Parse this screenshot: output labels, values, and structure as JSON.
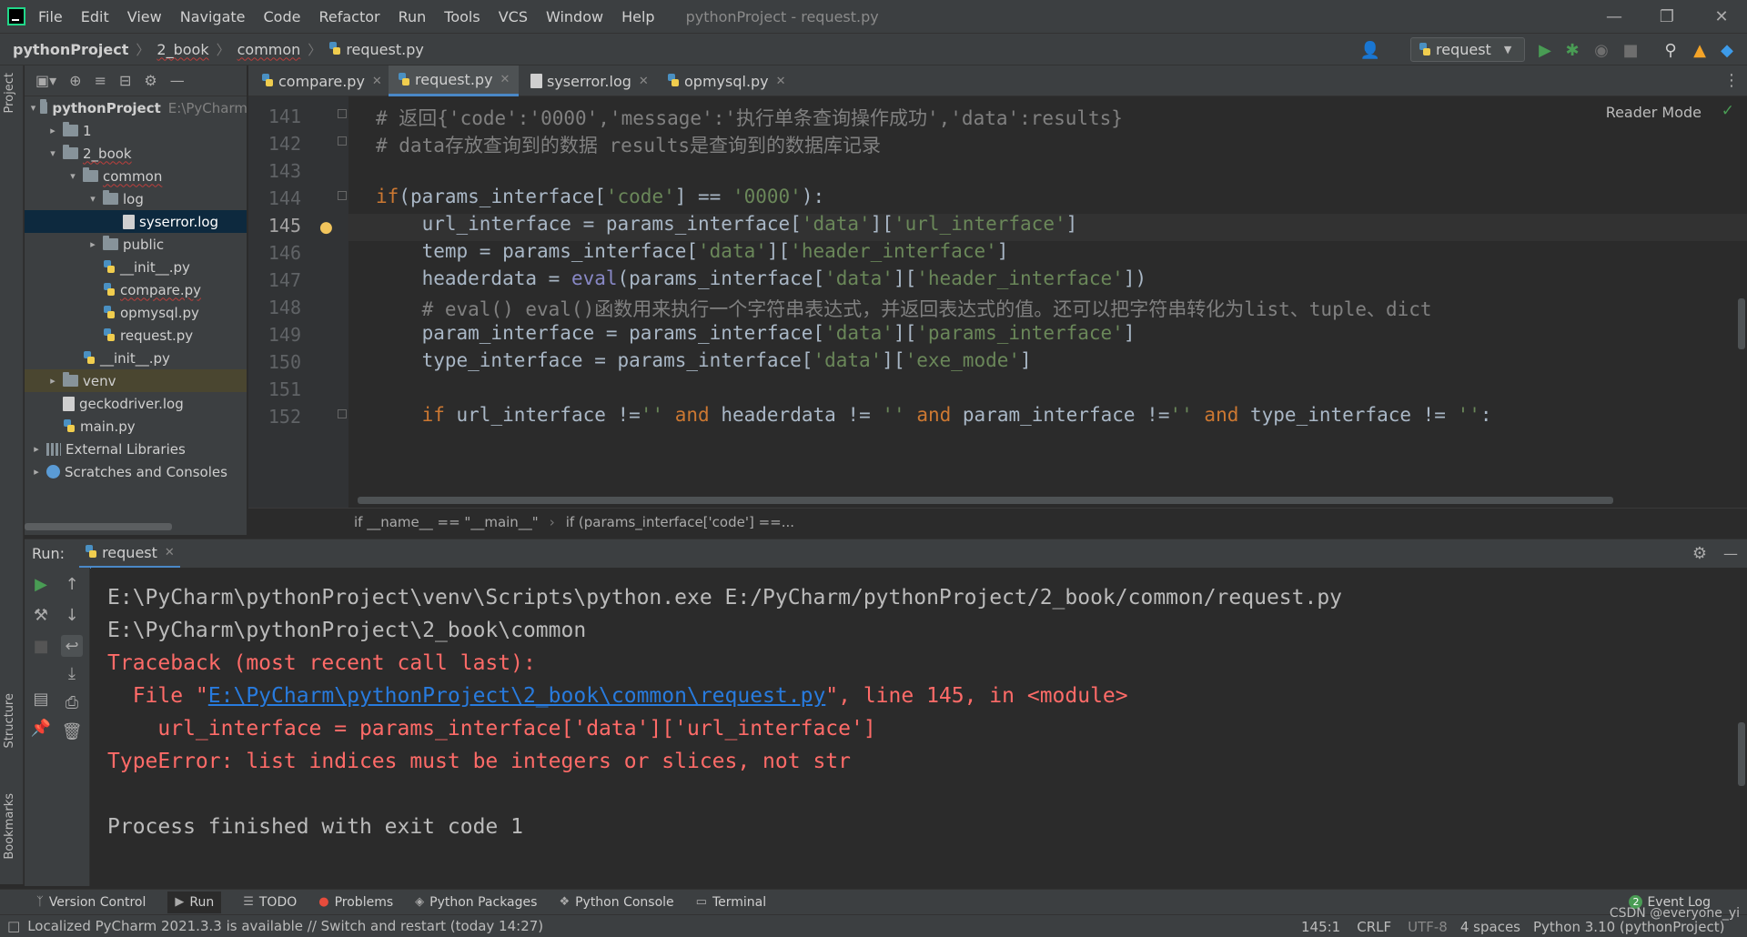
{
  "menubar": {
    "items": [
      "File",
      "Edit",
      "View",
      "Navigate",
      "Code",
      "Refactor",
      "Run",
      "Tools",
      "VCS",
      "Window",
      "Help"
    ],
    "title": "pythonProject - request.py"
  },
  "navbar": {
    "crumbs": [
      "pythonProject",
      "2_book",
      "common",
      "request.py"
    ],
    "run_config": "request"
  },
  "sidebar_labels": {
    "project": "Project",
    "structure": "Structure",
    "bookmarks": "Bookmarks"
  },
  "tree": [
    {
      "label": "pythonProject",
      "hint": "E:\\PyCharm",
      "icon": "folder-icon",
      "arrow": "▾"
    },
    {
      "label": "1",
      "icon": "folder-icon",
      "arrow": "▸"
    },
    {
      "label": "2_book",
      "icon": "folder-icon",
      "arrow": "▾"
    },
    {
      "label": "common",
      "icon": "folder-icon",
      "arrow": "▾"
    },
    {
      "label": "log",
      "icon": "folder-icon",
      "arrow": "▾"
    },
    {
      "label": "syserror.log",
      "icon": "log-file-icon"
    },
    {
      "label": "public",
      "icon": "folder-icon",
      "arrow": "▸"
    },
    {
      "label": "__init__.py",
      "icon": "python-file-icon"
    },
    {
      "label": "compare.py",
      "icon": "python-file-icon"
    },
    {
      "label": "opmysql.py",
      "icon": "python-file-icon"
    },
    {
      "label": "request.py",
      "icon": "python-file-icon"
    },
    {
      "label": "__init__.py",
      "icon": "python-file-icon"
    },
    {
      "label": "venv",
      "icon": "folder-icon",
      "arrow": "▸"
    },
    {
      "label": "geckodriver.log",
      "icon": "log-file-icon"
    },
    {
      "label": "main.py",
      "icon": "python-file-icon"
    },
    {
      "label": "External Libraries",
      "icon": "library-icon",
      "arrow": "▸"
    },
    {
      "label": "Scratches and Consoles",
      "icon": "scratches-icon",
      "arrow": "▸"
    }
  ],
  "tabs": [
    {
      "label": "compare.py",
      "active": false
    },
    {
      "label": "request.py",
      "active": true
    },
    {
      "label": "syserror.log",
      "active": false
    },
    {
      "label": "opmysql.py",
      "active": false
    }
  ],
  "editor": {
    "reader_mode": "Reader Mode",
    "line_numbers": [
      "141",
      "142",
      "143",
      "144",
      "145",
      "146",
      "147",
      "148",
      "149",
      "150",
      "151",
      "152"
    ],
    "current_line": "145"
  },
  "code_breadcrumb": [
    "if __name__ == \"__main__\"",
    "if (params_interface['code'] ==..."
  ],
  "run": {
    "label": "Run:",
    "tab": "request",
    "lines": [
      "E:\\PyCharm\\pythonProject\\venv\\Scripts\\python.exe E:/PyCharm/pythonProject/2_book/common/request.py",
      "E:\\PyCharm\\pythonProject\\2_book\\common",
      "Traceback (most recent call last):",
      "  File \"",
      "E:\\PyCharm\\pythonProject\\2_book\\common\\request.py",
      "\", line 145, in <module>",
      "    url_interface = params_interface['data']['url_interface']",
      "TypeError: list indices must be integers or slices, not str",
      "Process finished with exit code 1"
    ]
  },
  "bottombar": [
    "Version Control",
    "Run",
    "TODO",
    "Problems",
    "Python Packages",
    "Python Console",
    "Terminal"
  ],
  "event_log": {
    "count": "2",
    "label": "Event Log"
  },
  "status": {
    "message": "Localized PyCharm 2021.3.3 is available // Switch and restart (today 14:27)",
    "position": "145:1",
    "line_sep": "CRLF",
    "encoding": "UTF-8",
    "indent": "4 spaces",
    "interpreter": "Python 3.10 (pythonProject)",
    "watermark": "CSDN @everyone_yi"
  }
}
